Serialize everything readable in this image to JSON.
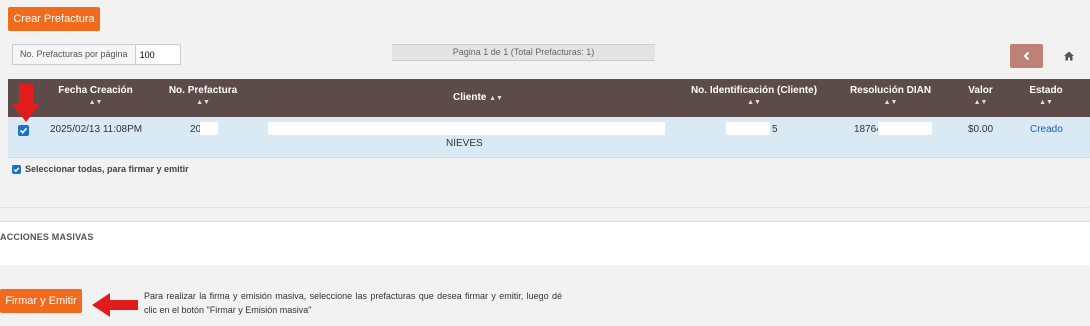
{
  "toolbar": {
    "create_label": "Crear Prefactura"
  },
  "pagination": {
    "per_page_label": "No. Prefacturas por página",
    "per_page_value": "100",
    "status": "Pagina 1 de 1 (Total Prefacturas: 1)"
  },
  "table": {
    "headers": {
      "fecha": "Fecha Creación",
      "prefactura": "No. Prefactura",
      "cliente": "Cliente",
      "identificacion": "No. Identificación (Cliente)",
      "resolucion": "Resolución DIAN",
      "valor": "Valor",
      "estado": "Estado"
    },
    "sort_glyph": "▲▼",
    "rows": [
      {
        "fecha": "2025/02/13 11:08PM",
        "prefactura": "20",
        "cliente_line2": "NIEVES",
        "identificacion": "5",
        "resolucion": "18764",
        "valor": "$0.00",
        "estado": "Creado"
      }
    ]
  },
  "select_all_label": "Seleccionar todas, para firmar y emitir",
  "bulk": {
    "title": "ACCIONES MASIVAS",
    "sign_label": "Firmar y Emitir",
    "info": "Para realizar la firma y emisión masiva, seleccione las prefacturas que desea firmar y emitir, luego dé clic en el botón \"Firmar y Emisión masiva\""
  },
  "colors": {
    "accent": "#f26a1b",
    "header_bg": "#5c4b49",
    "row_bg": "#d9eaf4",
    "back_button": "#bd8175",
    "link": "#1a5fb4",
    "annotation_arrow": "#e21b1b"
  },
  "icons": [
    "chevron-left-icon",
    "home-icon",
    "sort-icon",
    "checkbox-checked-icon",
    "red-arrow-annotation"
  ]
}
